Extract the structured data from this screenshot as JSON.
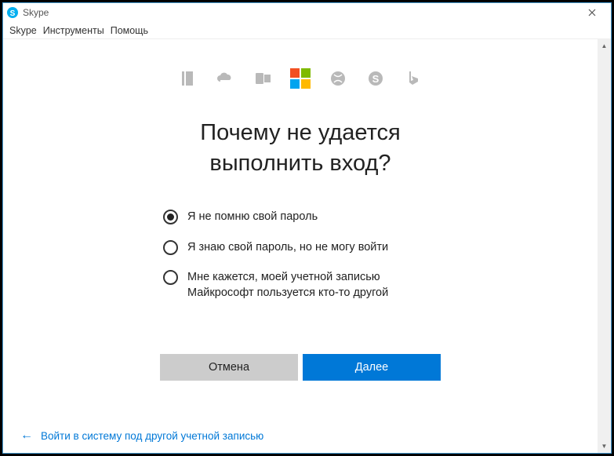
{
  "window": {
    "title": "Skype"
  },
  "menu": {
    "skype": "Skype",
    "tools": "Инструменты",
    "help": "Помощь"
  },
  "heading": {
    "line1": "Почему не удается",
    "line2": "выполнить вход?"
  },
  "options": {
    "opt1": "Я не помню свой пароль",
    "opt2": "Я знаю свой пароль, но не могу войти",
    "opt3": "Мне кажется, моей учетной записью Майкрософт пользуется кто-то другой"
  },
  "buttons": {
    "cancel": "Отмена",
    "next": "Далее"
  },
  "footer": {
    "other_account": "Войти в систему под другой учетной записью"
  }
}
